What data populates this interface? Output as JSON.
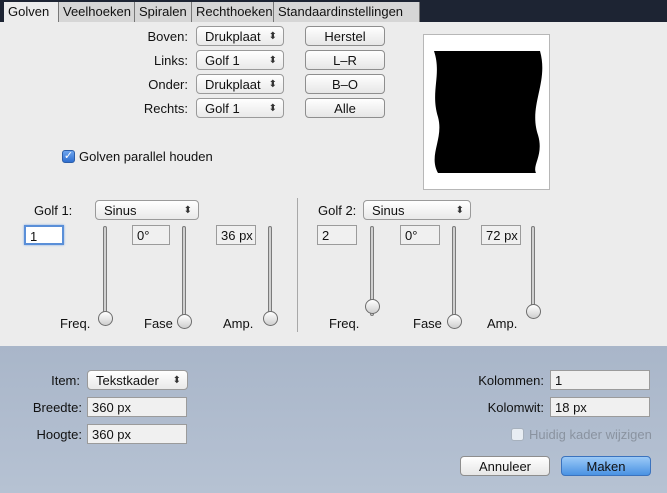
{
  "tabs": [
    "Golven",
    "Veelhoeken",
    "Spiralen",
    "Rechthoeken",
    "Standaardinstellingen"
  ],
  "edges": {
    "top_label": "Boven:",
    "top_value": "Drukplaat",
    "left_label": "Links:",
    "left_value": "Golf 1",
    "bottom_label": "Onder:",
    "bottom_value": "Drukplaat",
    "right_label": "Rechts:",
    "right_value": "Golf 1"
  },
  "buttons": {
    "reset": "Herstel",
    "lr": "L–R",
    "bo": "B–O",
    "all": "Alle",
    "cancel": "Annuleer",
    "make": "Maken"
  },
  "parallel": {
    "label": "Golven parallel houden",
    "checked": true
  },
  "wave1": {
    "label": "Golf 1:",
    "type": "Sinus",
    "freq": "1",
    "phase": "0°",
    "amp": "36 px",
    "freq_label": "Freq.",
    "phase_label": "Fase",
    "amp_label": "Amp.",
    "freq_level": 0.0,
    "phase_level": 0.0,
    "amp_level": 0.0
  },
  "wave2": {
    "label": "Golf 2:",
    "type": "Sinus",
    "freq": "2",
    "phase": "0°",
    "amp": "72 px",
    "freq_label": "Freq.",
    "phase_label": "Fase",
    "amp_label": "Amp.",
    "freq_level": 0.15,
    "phase_level": 0.0,
    "amp_level": 0.1
  },
  "item": {
    "item_label": "Item:",
    "item_value": "Tekstkader",
    "width_label": "Breedte:",
    "width_value": "360 px",
    "height_label": "Hoogte:",
    "height_value": "360 px",
    "columns_label": "Kolommen:",
    "columns_value": "1",
    "gutter_label": "Kolomwit:",
    "gutter_value": "18 px",
    "modify_label": "Huidig kader wijzigen",
    "modify_checked": false
  },
  "colors": {
    "accent": "#4a92e3",
    "bottom_panel": "#b0bdd0",
    "tabbar": "#1d2433"
  }
}
